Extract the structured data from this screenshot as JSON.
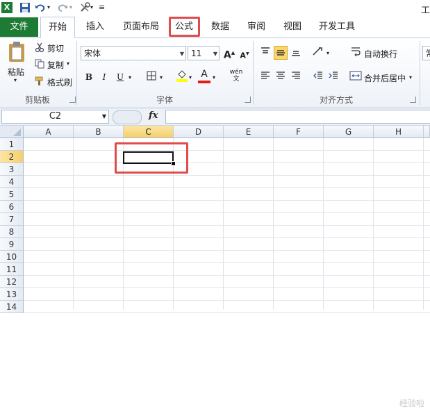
{
  "window": {
    "title_fragment": "工"
  },
  "tabs": {
    "file": "文件",
    "home": "开始",
    "insert": "插入",
    "page_layout": "页面布局",
    "formulas": "公式",
    "data": "数据",
    "review": "审阅",
    "view": "视图",
    "developer": "开发工具"
  },
  "clipboard": {
    "paste": "粘贴",
    "cut": "剪切",
    "copy": "复制",
    "format_painter": "格式刷",
    "group_label": "剪贴板"
  },
  "font": {
    "font_name": "宋体",
    "font_size": "11",
    "bold": "B",
    "italic": "I",
    "underline": "U",
    "font_color_letter": "A",
    "phonetic": "wén",
    "group_label": "字体"
  },
  "alignment": {
    "wrap_text": "自动换行",
    "merge_center": "合并后居中",
    "group_label": "对齐方式"
  },
  "number": {
    "partial_label": "常"
  },
  "formula_bar": {
    "name_box": "C2",
    "fx": "fx",
    "content": ""
  },
  "grid": {
    "columns": [
      "A",
      "B",
      "C",
      "D",
      "E",
      "F",
      "G",
      "H"
    ],
    "rows": [
      "1",
      "2",
      "3",
      "4",
      "5",
      "6",
      "7",
      "8",
      "9",
      "10",
      "11",
      "12",
      "13",
      "14"
    ],
    "selected_cell": "C2",
    "selected_column": "C",
    "selected_row": "2"
  },
  "watermark": "经验啦",
  "colors": {
    "file_tab": "#1e7b34",
    "highlight_red": "#e04c4c",
    "selected_header": "#f6cf6a"
  }
}
